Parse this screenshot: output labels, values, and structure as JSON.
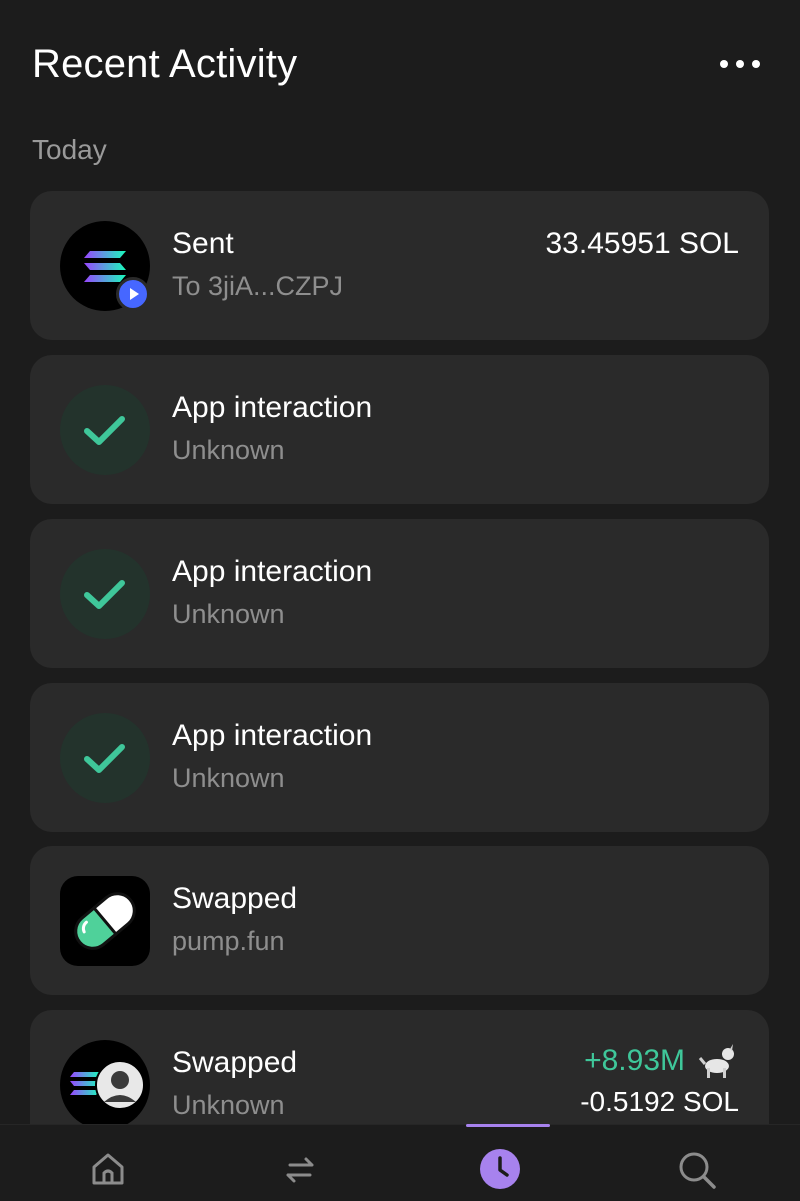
{
  "header": {
    "title": "Recent Activity",
    "menu_icon": "more-horizontal-icon"
  },
  "section": {
    "label": "Today"
  },
  "activities": [
    {
      "title": "Sent",
      "subtitle": "To 3jiA...CZPJ",
      "amount": "33.45951 SOL",
      "icon": "solana-logo-icon",
      "badge": "send-play-icon"
    },
    {
      "title": "App interaction",
      "subtitle": "Unknown",
      "icon": "check-icon"
    },
    {
      "title": "App interaction",
      "subtitle": "Unknown",
      "icon": "check-icon"
    },
    {
      "title": "App interaction",
      "subtitle": "Unknown",
      "icon": "check-icon"
    },
    {
      "title": "Swapped",
      "subtitle": "pump.fun",
      "icon": "pump-fun-pill-icon"
    },
    {
      "title": "Swapped",
      "subtitle": "Unknown",
      "amount_in": "+8.93M",
      "amount_out": "-0.5192 SOL",
      "icon": "token-swap-icon",
      "token_icon": "dog-emoji-icon"
    }
  ],
  "tabbar": {
    "tabs": [
      {
        "name": "home",
        "icon": "home-icon",
        "active": false
      },
      {
        "name": "swap",
        "icon": "swap-arrows-icon",
        "active": false
      },
      {
        "name": "activity",
        "icon": "clock-icon",
        "active": true
      },
      {
        "name": "search",
        "icon": "search-icon",
        "active": false
      }
    ]
  },
  "colors": {
    "background": "#1c1c1c",
    "card": "#2a2a2a",
    "accent": "#a782ee",
    "positive": "#3fc79a",
    "check": "#3fc79a",
    "muted_text": "#8e8e8e"
  }
}
